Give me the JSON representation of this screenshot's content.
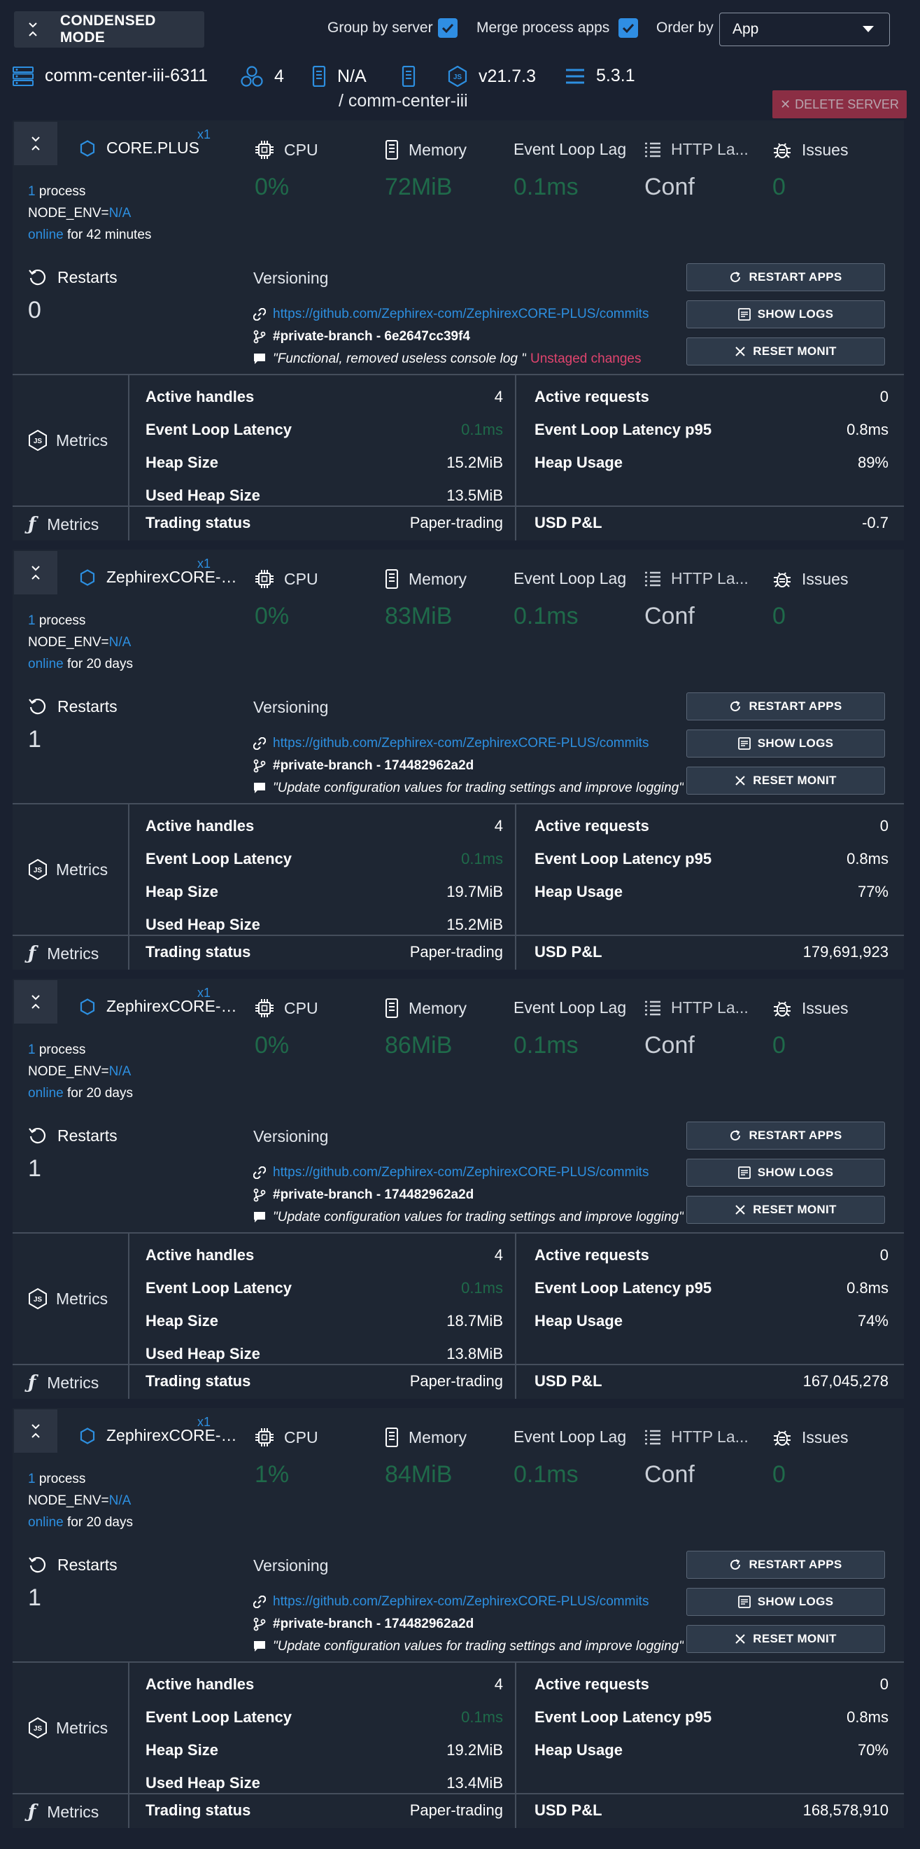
{
  "toolbar": {
    "condensed_label": "CONDENSED MODE",
    "group_by_server_label": "Group by server",
    "merge_process_label": "Merge process apps",
    "order_by_label": "Order by",
    "order_by_value": "App"
  },
  "server": {
    "name": "comm-center-iii-6311",
    "process_count": "4",
    "env": "N/A",
    "node_version": "v21.7.3",
    "pm2_version": "5.3.1",
    "path": "/ comm-center-iii",
    "delete_label": "DELETE SERVER"
  },
  "labels": {
    "cpu": "CPU",
    "memory": "Memory",
    "event_loop_lag": "Event Loop Lag",
    "http_latency": "HTTP La...",
    "issues": "Issues",
    "restarts": "Restarts",
    "versioning": "Versioning",
    "restart_apps": "RESTART APPS",
    "show_logs": "SHOW LOGS",
    "reset_monit": "RESET MONIT",
    "metrics": "Metrics",
    "active_handles": "Active handles",
    "event_loop_latency": "Event Loop Latency",
    "heap_size": "Heap Size",
    "used_heap_size": "Used Heap Size",
    "active_requests": "Active requests",
    "event_loop_latency_p95": "Event Loop Latency p95",
    "heap_usage": "Heap Usage",
    "trading_status": "Trading status",
    "usd_pnl": "USD P&L",
    "process": "process",
    "node_env": "NODE_ENV=",
    "online": "online",
    "http_value": "Conf"
  },
  "apps": [
    {
      "name": "CORE.PLUS",
      "instances": "x1",
      "process_count": "1",
      "node_env": "N/A",
      "uptime": "for 42 minutes",
      "cpu": "0%",
      "memory": "72MiB",
      "event_loop_lag": "0.1ms",
      "issues": "0",
      "restarts": "0",
      "repo_url": "https://github.com/Zephirex-com/ZephirexCORE-PLUS/commits",
      "branch": "#private-branch - 6e2647cc39f4",
      "commit_message": "\"Functional, removed useless console log \"",
      "unstaged": "Unstaged changes",
      "active_handles": "4",
      "event_loop_latency": "0.1ms",
      "heap_size": "15.2MiB",
      "used_heap_size": "13.5MiB",
      "active_requests": "0",
      "event_loop_latency_p95": "0.8ms",
      "heap_usage": "89%",
      "trading_status": "Paper-trading",
      "usd_pnl": "-0.7"
    },
    {
      "name": "ZephirexCORE-PLUS",
      "instances": "x1",
      "process_count": "1",
      "node_env": "N/A",
      "uptime": "for 20 days",
      "cpu": "0%",
      "memory": "83MiB",
      "event_loop_lag": "0.1ms",
      "issues": "0",
      "restarts": "1",
      "repo_url": "https://github.com/Zephirex-com/ZephirexCORE-PLUS/commits",
      "branch": "#private-branch - 174482962a2d",
      "commit_message": "\"Update configuration values for trading settings and improve logging\"",
      "unstaged": "",
      "active_handles": "4",
      "event_loop_latency": "0.1ms",
      "heap_size": "19.7MiB",
      "used_heap_size": "15.2MiB",
      "active_requests": "0",
      "event_loop_latency_p95": "0.8ms",
      "heap_usage": "77%",
      "trading_status": "Paper-trading",
      "usd_pnl": "179,691,923"
    },
    {
      "name": "ZephirexCORE-PLUS",
      "instances": "x1",
      "process_count": "1",
      "node_env": "N/A",
      "uptime": "for 20 days",
      "cpu": "0%",
      "memory": "86MiB",
      "event_loop_lag": "0.1ms",
      "issues": "0",
      "restarts": "1",
      "repo_url": "https://github.com/Zephirex-com/ZephirexCORE-PLUS/commits",
      "branch": "#private-branch - 174482962a2d",
      "commit_message": "\"Update configuration values for trading settings and improve logging\"",
      "unstaged": "",
      "active_handles": "4",
      "event_loop_latency": "0.1ms",
      "heap_size": "18.7MiB",
      "used_heap_size": "13.8MiB",
      "active_requests": "0",
      "event_loop_latency_p95": "0.8ms",
      "heap_usage": "74%",
      "trading_status": "Paper-trading",
      "usd_pnl": "167,045,278"
    },
    {
      "name": "ZephirexCORE-PLUS",
      "instances": "x1",
      "process_count": "1",
      "node_env": "N/A",
      "uptime": "for 20 days",
      "cpu": "1%",
      "memory": "84MiB",
      "event_loop_lag": "0.1ms",
      "issues": "0",
      "restarts": "1",
      "repo_url": "https://github.com/Zephirex-com/ZephirexCORE-PLUS/commits",
      "branch": "#private-branch - 174482962a2d",
      "commit_message": "\"Update configuration values for trading settings and improve logging\"",
      "unstaged": "",
      "active_handles": "4",
      "event_loop_latency": "0.1ms",
      "heap_size": "19.2MiB",
      "used_heap_size": "13.4MiB",
      "active_requests": "0",
      "event_loop_latency_p95": "0.8ms",
      "heap_usage": "70%",
      "trading_status": "Paper-trading",
      "usd_pnl": "168,578,910"
    }
  ],
  "colors": {
    "background": "#1a2130",
    "card": "#1e2633",
    "accent_blue": "#2d8fe0",
    "value_green": "#1f6a4a",
    "unstaged_red": "#e0446e",
    "delete_red": "#b7344d"
  }
}
